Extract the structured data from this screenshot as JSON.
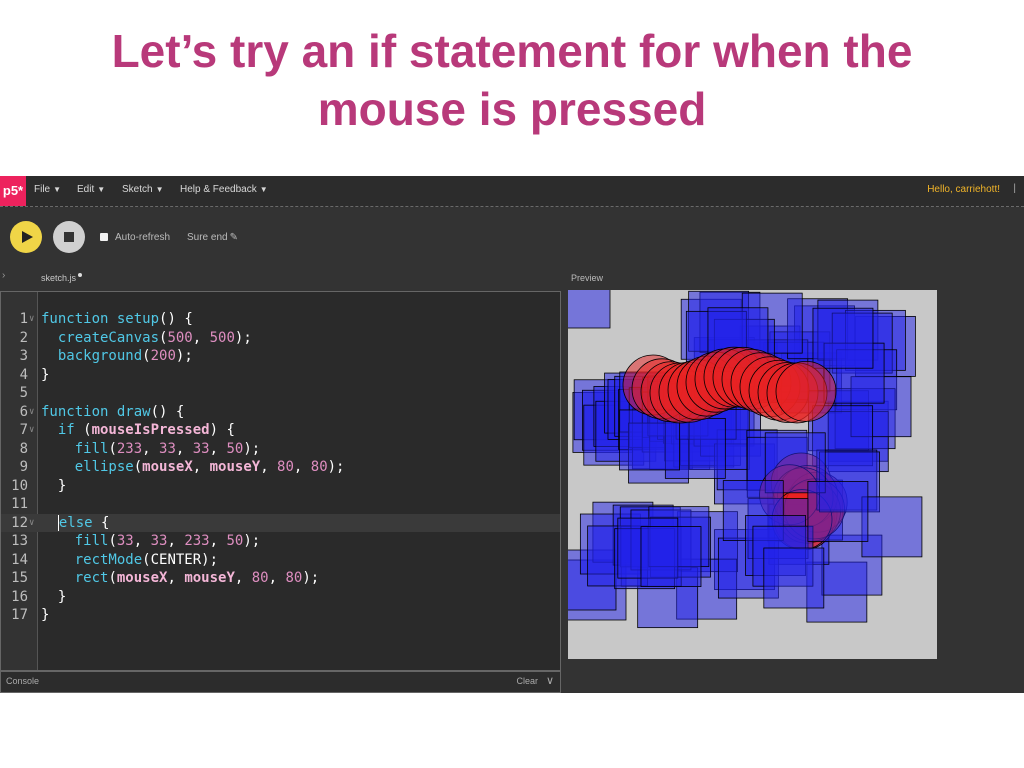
{
  "slide": {
    "title_line1": "Let’s try an if statement for when the",
    "title_line2": "mouse is pressed"
  },
  "app": {
    "logo": "p5*",
    "menu": [
      {
        "label": "File"
      },
      {
        "label": "Edit"
      },
      {
        "label": "Sketch"
      },
      {
        "label": "Help & Feedback"
      }
    ],
    "greeting": "Hello, carriehott!",
    "greeting_separator": "|",
    "toolbar": {
      "auto_refresh_label": "Auto-refresh",
      "auto_refresh_checked": false,
      "sketch_name": "Sure end"
    },
    "editor": {
      "tab_name": "sketch.js",
      "unsaved": true
    },
    "preview_label": "Preview",
    "console": {
      "label": "Console",
      "clear_label": "Clear"
    },
    "colors": {
      "accent": "#ed225d",
      "play": "#f0d547",
      "greeting": "#f0b429",
      "keyword": "#50c8e6",
      "number": "#de8ec0",
      "variable": "#f4b6d7",
      "ellipse_fill": "rgba(233,33,33,0.5)",
      "rect_fill": "rgba(33,33,233,0.5)",
      "canvas_bg": "#c8c8c8"
    },
    "icons": [
      "play-icon",
      "stop-icon",
      "pencil-icon",
      "chevron-right-icon",
      "chevron-down-icon",
      "fold-arrow-icon"
    ]
  },
  "code": [
    {
      "n": "1",
      "fold": true,
      "tokens": [
        {
          "t": "kw",
          "v": "function"
        },
        {
          "t": "",
          "v": " "
        },
        {
          "t": "fn",
          "v": "setup"
        },
        {
          "t": "",
          "v": "() {"
        }
      ]
    },
    {
      "n": "2",
      "tokens": [
        {
          "t": "",
          "v": "  "
        },
        {
          "t": "fn",
          "v": "createCanvas"
        },
        {
          "t": "",
          "v": "("
        },
        {
          "t": "num",
          "v": "500"
        },
        {
          "t": "",
          "v": ", "
        },
        {
          "t": "num",
          "v": "500"
        },
        {
          "t": "",
          "v": ");"
        }
      ]
    },
    {
      "n": "3",
      "tokens": [
        {
          "t": "",
          "v": "  "
        },
        {
          "t": "fn",
          "v": "background"
        },
        {
          "t": "",
          "v": "("
        },
        {
          "t": "num",
          "v": "200"
        },
        {
          "t": "",
          "v": ");"
        }
      ]
    },
    {
      "n": "4",
      "tokens": [
        {
          "t": "",
          "v": "}"
        }
      ]
    },
    {
      "n": "5",
      "tokens": []
    },
    {
      "n": "6",
      "fold": true,
      "tokens": [
        {
          "t": "kw",
          "v": "function"
        },
        {
          "t": "",
          "v": " "
        },
        {
          "t": "fn",
          "v": "draw"
        },
        {
          "t": "",
          "v": "() {"
        }
      ]
    },
    {
      "n": "7",
      "fold": true,
      "tokens": [
        {
          "t": "",
          "v": "  "
        },
        {
          "t": "kw",
          "v": "if"
        },
        {
          "t": "",
          "v": " ("
        },
        {
          "t": "var",
          "v": "mouseIsPressed"
        },
        {
          "t": "",
          "v": ") {"
        }
      ]
    },
    {
      "n": "8",
      "tokens": [
        {
          "t": "",
          "v": "    "
        },
        {
          "t": "fn",
          "v": "fill"
        },
        {
          "t": "",
          "v": "("
        },
        {
          "t": "num",
          "v": "233"
        },
        {
          "t": "",
          "v": ", "
        },
        {
          "t": "num",
          "v": "33"
        },
        {
          "t": "",
          "v": ", "
        },
        {
          "t": "num",
          "v": "33"
        },
        {
          "t": "",
          "v": ", "
        },
        {
          "t": "num",
          "v": "50"
        },
        {
          "t": "",
          "v": ");"
        }
      ]
    },
    {
      "n": "9",
      "tokens": [
        {
          "t": "",
          "v": "    "
        },
        {
          "t": "fn",
          "v": "ellipse"
        },
        {
          "t": "",
          "v": "("
        },
        {
          "t": "var",
          "v": "mouseX"
        },
        {
          "t": "",
          "v": ", "
        },
        {
          "t": "var",
          "v": "mouseY"
        },
        {
          "t": "",
          "v": ", "
        },
        {
          "t": "num",
          "v": "80"
        },
        {
          "t": "",
          "v": ", "
        },
        {
          "t": "num",
          "v": "80"
        },
        {
          "t": "",
          "v": ");"
        }
      ]
    },
    {
      "n": "10",
      "tokens": [
        {
          "t": "",
          "v": "  }"
        }
      ]
    },
    {
      "n": "11",
      "tokens": []
    },
    {
      "n": "12",
      "fold": true,
      "active": true,
      "tokens": [
        {
          "t": "",
          "v": "  "
        },
        {
          "t": "kw",
          "v": "else"
        },
        {
          "t": "",
          "v": " {"
        }
      ]
    },
    {
      "n": "13",
      "tokens": [
        {
          "t": "",
          "v": "    "
        },
        {
          "t": "fn",
          "v": "fill"
        },
        {
          "t": "",
          "v": "("
        },
        {
          "t": "num",
          "v": "33"
        },
        {
          "t": "",
          "v": ", "
        },
        {
          "t": "num",
          "v": "33"
        },
        {
          "t": "",
          "v": ", "
        },
        {
          "t": "num",
          "v": "233"
        },
        {
          "t": "",
          "v": ", "
        },
        {
          "t": "num",
          "v": "50"
        },
        {
          "t": "",
          "v": ");"
        }
      ]
    },
    {
      "n": "14",
      "tokens": [
        {
          "t": "",
          "v": "    "
        },
        {
          "t": "fn",
          "v": "rectMode"
        },
        {
          "t": "",
          "v": "(CENTER);"
        }
      ]
    },
    {
      "n": "15",
      "tokens": [
        {
          "t": "",
          "v": "    "
        },
        {
          "t": "fn",
          "v": "rect"
        },
        {
          "t": "",
          "v": "("
        },
        {
          "t": "var",
          "v": "mouseX"
        },
        {
          "t": "",
          "v": ", "
        },
        {
          "t": "var",
          "v": "mouseY"
        },
        {
          "t": "",
          "v": ", "
        },
        {
          "t": "num",
          "v": "80"
        },
        {
          "t": "",
          "v": ", "
        },
        {
          "t": "num",
          "v": "80"
        },
        {
          "t": "",
          "v": ");"
        }
      ]
    },
    {
      "n": "16",
      "tokens": [
        {
          "t": "",
          "v": "  }"
        }
      ]
    },
    {
      "n": "17",
      "tokens": [
        {
          "t": "",
          "v": "}"
        }
      ]
    }
  ]
}
